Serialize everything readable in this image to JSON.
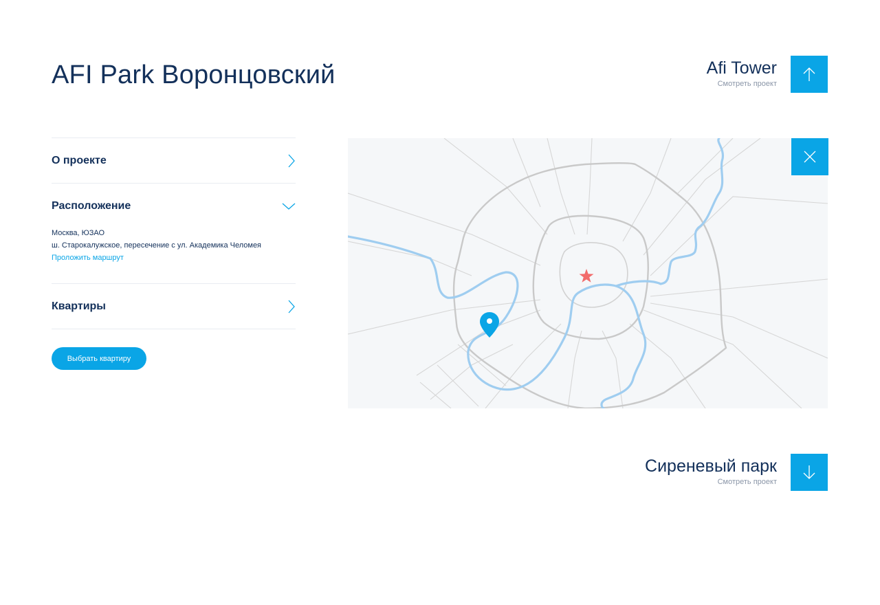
{
  "page": {
    "title": "AFI Park Воронцовский"
  },
  "nav": {
    "prev": {
      "name": "Afi Tower",
      "link": "Смотреть проект"
    },
    "next": {
      "name": "Сиреневый парк",
      "link": "Смотреть проект"
    }
  },
  "accordion": {
    "about": {
      "label": "О проекте",
      "icon": "chevron-right-icon"
    },
    "location": {
      "label": "Расположение",
      "icon": "chevron-down-icon",
      "city": "Москва, ЮЗАО",
      "address": "ш. Старокалужское, пересечение с ул. Академика Челомея",
      "route": "Проложить маршрут"
    },
    "apartments": {
      "label": "Квартиры",
      "icon": "chevron-right-icon"
    }
  },
  "cta": {
    "label": "Выбрать квартиру"
  },
  "colors": {
    "accent": "#0aa5e6",
    "text": "#13305a",
    "muted": "#8b96a8",
    "river": "#9fcdf0",
    "roads": "#cfcfcf",
    "star": "#f26b6b"
  }
}
